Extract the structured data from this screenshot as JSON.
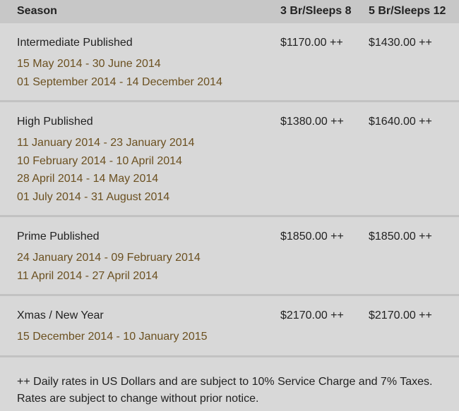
{
  "header": {
    "season": "Season",
    "col_a": "3 Br/Sleeps 8",
    "col_b": "5 Br/Sleeps 12"
  },
  "rows": [
    {
      "name": "Intermediate Published",
      "price_a": "$1170.00 ++",
      "price_b": "$1430.00 ++",
      "dates": [
        "15 May 2014 - 30 June 2014",
        "01 September 2014 - 14 December 2014"
      ]
    },
    {
      "name": "High Published",
      "price_a": "$1380.00 ++",
      "price_b": "$1640.00 ++",
      "dates": [
        "11 January 2014 - 23 January 2014",
        "10 February 2014 - 10 April 2014",
        "28 April 2014 - 14 May 2014",
        "01 July 2014 - 31 August 2014"
      ]
    },
    {
      "name": "Prime Published",
      "price_a": "$1850.00 ++",
      "price_b": "$1850.00 ++",
      "dates": [
        "24 January 2014 - 09 February 2014",
        "11 April 2014 - 27 April 2014"
      ]
    },
    {
      "name": "Xmas / New Year",
      "price_a": "$2170.00 ++",
      "price_b": "$2170.00 ++",
      "dates": [
        "15 December 2014 - 10 January 2015"
      ]
    }
  ],
  "footer": {
    "line1": "++ Daily rates in US Dollars and are subject to 10% Service Charge and 7% Taxes.",
    "line2": "Rates are subject to change without prior notice."
  },
  "colors": {
    "background": "#d8d8d8",
    "header_background": "#c7c7c7",
    "date_text": "#6b5020",
    "divider": "#c2c2c2"
  }
}
